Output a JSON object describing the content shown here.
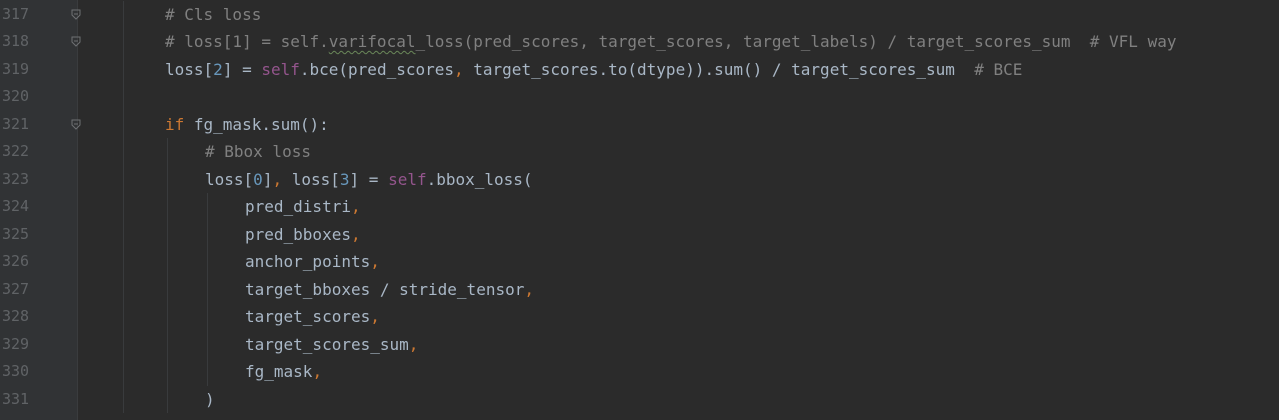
{
  "colors": {
    "background": "#2b2b2b",
    "gutter": "#313335",
    "line_number": "#606366",
    "comment": "#808080",
    "keyword": "#cc7832",
    "self": "#94558d",
    "number": "#6897bb",
    "text": "#a9b7c6"
  },
  "lines": [
    {
      "num": "317",
      "fold": true,
      "indent": 0,
      "tokens": [
        {
          "t": "# Cls loss",
          "c": "comment"
        }
      ]
    },
    {
      "num": "318",
      "fold": true,
      "indent": 0,
      "tokens": [
        {
          "t": "# loss[1] = self.",
          "c": "comment"
        },
        {
          "t": "varifocal",
          "c": "comment-squiggle"
        },
        {
          "t": "_loss(pred_scores, target_scores, target_labels) / target_scores_sum  # VFL way",
          "c": "comment"
        }
      ]
    },
    {
      "num": "319",
      "fold": false,
      "indent": 0,
      "tokens": [
        {
          "t": "loss[",
          "c": "text"
        },
        {
          "t": "2",
          "c": "number"
        },
        {
          "t": "] = ",
          "c": "text"
        },
        {
          "t": "self",
          "c": "self"
        },
        {
          "t": ".bce(pred_scores",
          "c": "text"
        },
        {
          "t": ",",
          "c": "punct"
        },
        {
          "t": " target_scores.to(dtype)).sum() / target_scores_sum  ",
          "c": "text"
        },
        {
          "t": "# BCE",
          "c": "comment"
        }
      ]
    },
    {
      "num": "320",
      "fold": false,
      "indent": 0,
      "tokens": []
    },
    {
      "num": "321",
      "fold": true,
      "indent": 0,
      "tokens": [
        {
          "t": "if",
          "c": "keyword"
        },
        {
          "t": " fg_mask.sum():",
          "c": "text"
        }
      ]
    },
    {
      "num": "322",
      "fold": false,
      "indent": 1,
      "tokens": [
        {
          "t": "# Bbox loss",
          "c": "comment"
        }
      ]
    },
    {
      "num": "323",
      "fold": false,
      "indent": 1,
      "tokens": [
        {
          "t": "loss[",
          "c": "text"
        },
        {
          "t": "0",
          "c": "number"
        },
        {
          "t": "]",
          "c": "text"
        },
        {
          "t": ",",
          "c": "punct"
        },
        {
          "t": " loss[",
          "c": "text"
        },
        {
          "t": "3",
          "c": "number"
        },
        {
          "t": "] = ",
          "c": "text"
        },
        {
          "t": "self",
          "c": "self"
        },
        {
          "t": ".bbox_loss(",
          "c": "text"
        }
      ]
    },
    {
      "num": "324",
      "fold": false,
      "indent": 2,
      "tokens": [
        {
          "t": "pred_distri",
          "c": "text"
        },
        {
          "t": ",",
          "c": "punct"
        }
      ]
    },
    {
      "num": "325",
      "fold": false,
      "indent": 2,
      "tokens": [
        {
          "t": "pred_bboxes",
          "c": "text"
        },
        {
          "t": ",",
          "c": "punct"
        }
      ]
    },
    {
      "num": "326",
      "fold": false,
      "indent": 2,
      "tokens": [
        {
          "t": "anchor_points",
          "c": "text"
        },
        {
          "t": ",",
          "c": "punct"
        }
      ]
    },
    {
      "num": "327",
      "fold": false,
      "indent": 2,
      "tokens": [
        {
          "t": "target_bboxes / stride_tensor",
          "c": "text"
        },
        {
          "t": ",",
          "c": "punct"
        }
      ]
    },
    {
      "num": "328",
      "fold": false,
      "indent": 2,
      "tokens": [
        {
          "t": "target_scores",
          "c": "text"
        },
        {
          "t": ",",
          "c": "punct"
        }
      ]
    },
    {
      "num": "329",
      "fold": false,
      "indent": 2,
      "tokens": [
        {
          "t": "target_scores_sum",
          "c": "text"
        },
        {
          "t": ",",
          "c": "punct"
        }
      ]
    },
    {
      "num": "330",
      "fold": false,
      "indent": 2,
      "tokens": [
        {
          "t": "fg_mask",
          "c": "text"
        },
        {
          "t": ",",
          "c": "punct"
        }
      ]
    },
    {
      "num": "331",
      "fold": false,
      "indent": 1,
      "tokens": [
        {
          "t": ")",
          "c": "text"
        }
      ]
    }
  ]
}
